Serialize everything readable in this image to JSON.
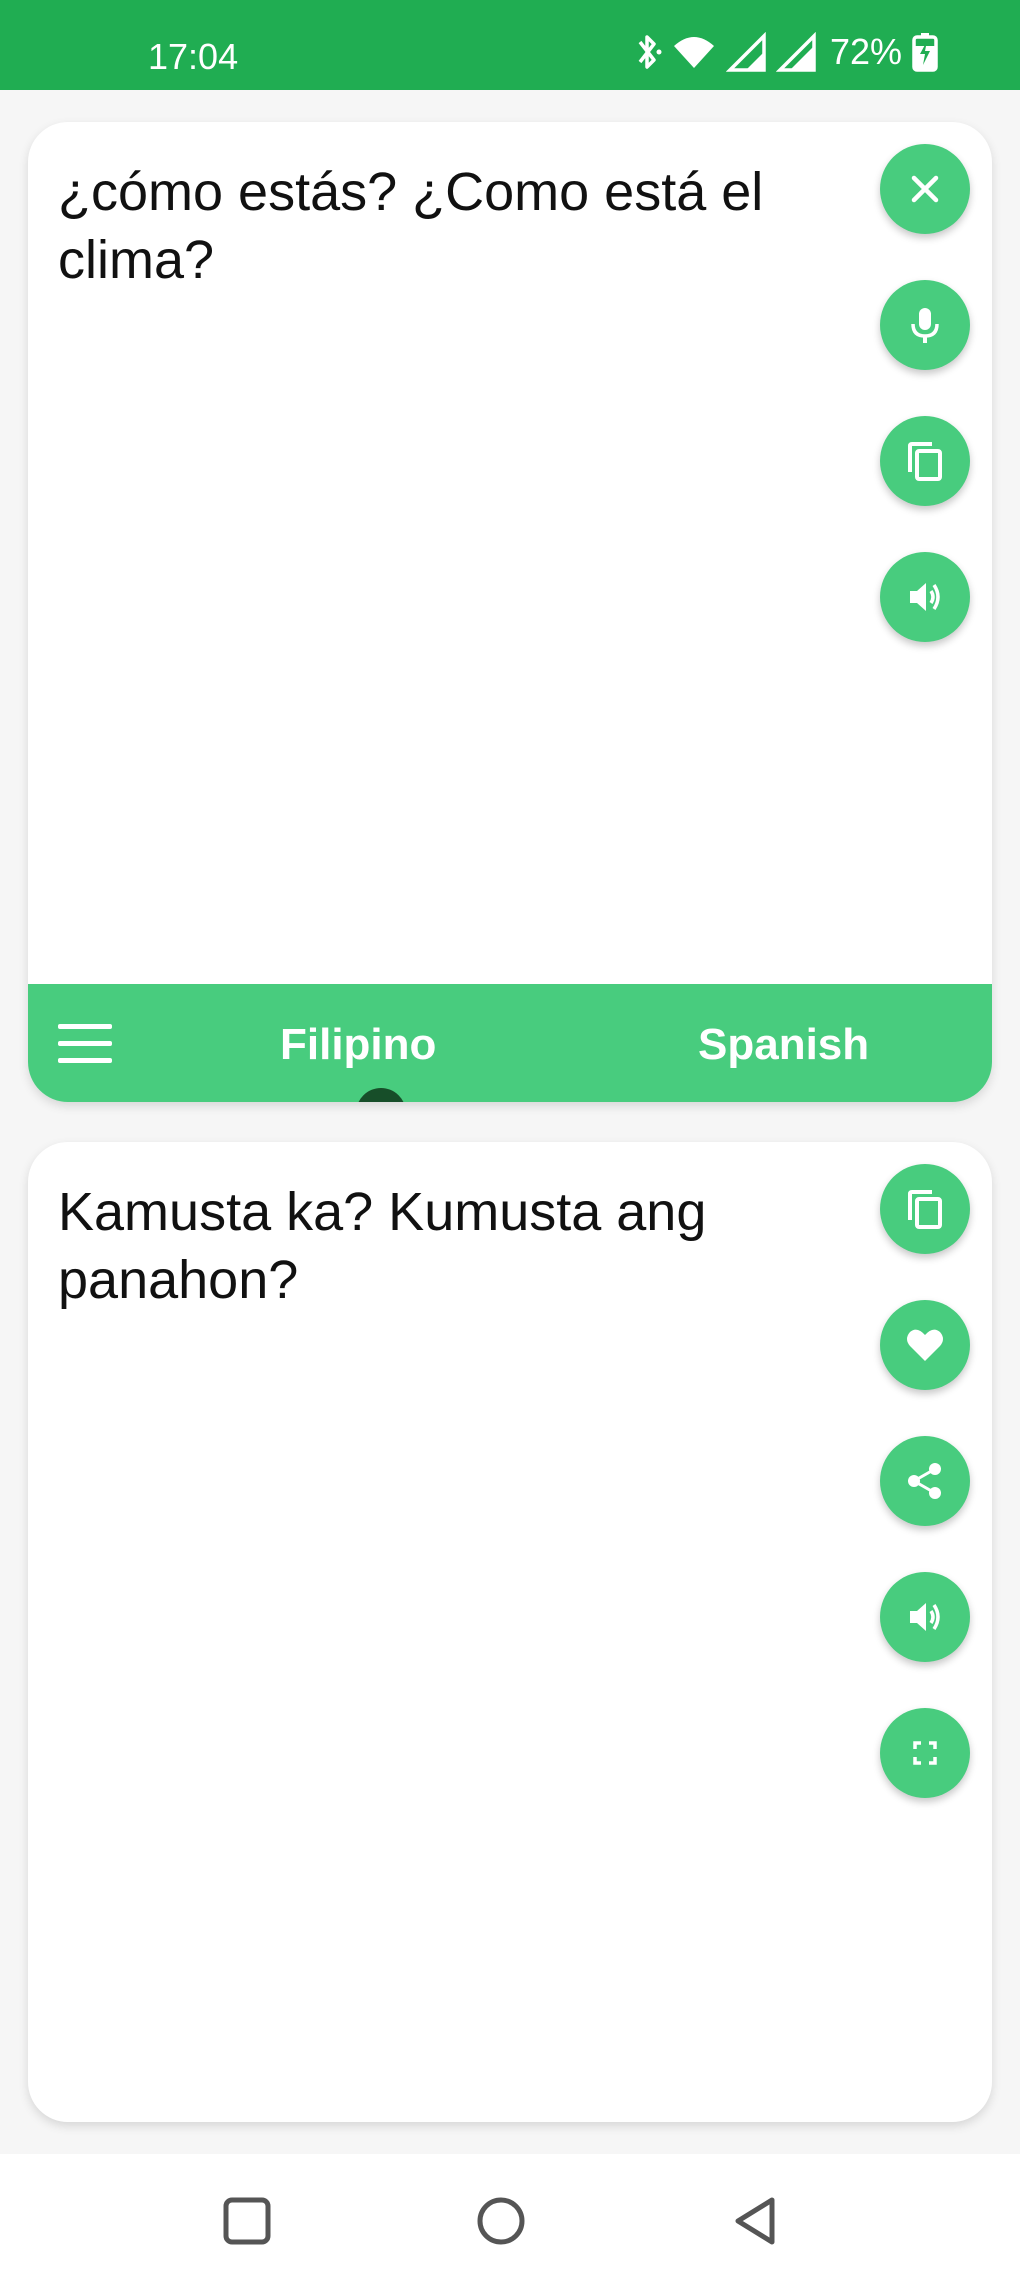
{
  "status_bar": {
    "time": "17:04",
    "battery": "72%",
    "icons": [
      "bluetooth-icon",
      "wifi-icon",
      "signal-icon",
      "signal-icon",
      "battery-charging-icon"
    ],
    "background": "#20ad52"
  },
  "source": {
    "text": "¿cómo estás? ¿Como está el clima?",
    "actions": [
      "close-icon",
      "mic-icon",
      "copy-icon",
      "speaker-icon"
    ]
  },
  "language_bar": {
    "source_language": "Filipino",
    "target_language": "Spanish",
    "accent": "#48cc7e",
    "check_color": "#174e29"
  },
  "target": {
    "text": "Kamusta ka? Kumusta ang panahon?",
    "actions": [
      "copy-icon",
      "heart-icon",
      "share-icon",
      "speaker-icon",
      "fullscreen-icon"
    ]
  },
  "nav_bar": {
    "buttons": [
      "recents-icon",
      "home-icon",
      "back-icon"
    ]
  }
}
